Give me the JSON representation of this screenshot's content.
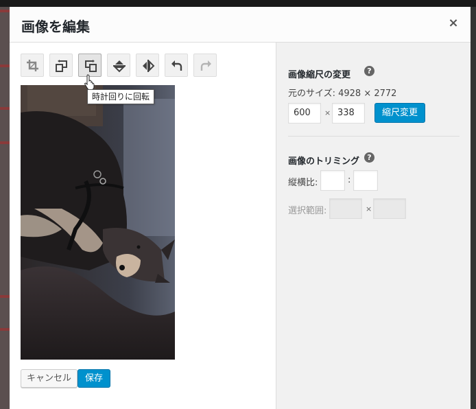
{
  "modal": {
    "title": "画像を編集",
    "close_symbol": "×"
  },
  "toolbar": {
    "buttons": [
      {
        "name": "crop",
        "icon": "crop-icon",
        "active": false,
        "disabled": false
      },
      {
        "name": "rotate-left",
        "icon": "rotate-counterclockwise-icon",
        "active": false,
        "disabled": false
      },
      {
        "name": "rotate-right",
        "icon": "rotate-clockwise-icon",
        "active": true,
        "disabled": false
      },
      {
        "name": "flip-vertical",
        "icon": "flip-vertical-icon",
        "active": false,
        "disabled": false
      },
      {
        "name": "flip-horizontal",
        "icon": "flip-horizontal-icon",
        "active": false,
        "disabled": false
      },
      {
        "name": "undo",
        "icon": "undo-icon",
        "active": false,
        "disabled": false
      },
      {
        "name": "redo",
        "icon": "redo-icon",
        "active": false,
        "disabled": true
      }
    ],
    "tooltip": "時計回りに回転"
  },
  "actions": {
    "cancel_label": "キャンセル",
    "save_label": "保存"
  },
  "scale": {
    "title": "画像縮尺の変更",
    "original_size": "元のサイズ: 4928 × 2772",
    "width_value": "600",
    "height_value": "338",
    "times": "×",
    "button_label": "縮尺変更"
  },
  "crop": {
    "title": "画像のトリミング",
    "ratio_label": "縦横比:",
    "ratio_separator": ":",
    "ratio_width_value": "",
    "ratio_height_value": "",
    "selection_label": "選択範囲:",
    "selection_times": "×",
    "selection_width_value": "",
    "selection_height_value": ""
  },
  "help_symbol": "?",
  "colors": {
    "primary_button": "#0091cd",
    "sidebar_bg": "#f1f1f1",
    "header_bg": "#fcfcfc"
  }
}
